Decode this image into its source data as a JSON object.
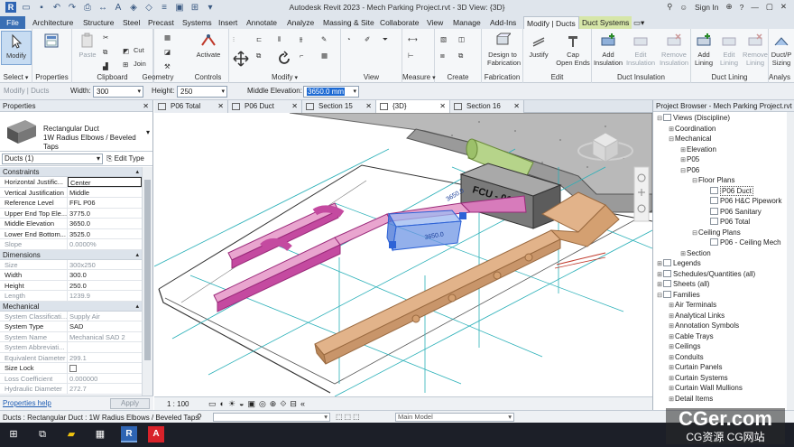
{
  "app": {
    "title": "Autodesk Revit 2023 - Mech Parking Project.rvt - 3D View: {3D}",
    "sign_in": "Sign In",
    "logo": "R"
  },
  "tabs": [
    "File",
    "Architecture",
    "Structure",
    "Steel",
    "Precast",
    "Systems",
    "Insert",
    "Annotate",
    "Analyze",
    "Massing & Site",
    "Collaborate",
    "View",
    "Manage",
    "Add-Ins",
    "Modify | Ducts",
    "Duct Systems"
  ],
  "ribbon": {
    "select": {
      "button": "Modify",
      "label": "Select"
    },
    "properties": {
      "label": "Properties"
    },
    "clipboard": {
      "paste": "Paste",
      "cut": "Cut",
      "join": "Join",
      "label": "Clipboard"
    },
    "geometry": {
      "label": "Geometry"
    },
    "controls": {
      "activate": "Activate",
      "label": "Controls"
    },
    "modify": {
      "label": "Modify"
    },
    "view": {
      "label": "View"
    },
    "measure": {
      "label": "Measure"
    },
    "create": {
      "label": "Create"
    },
    "fabrication": {
      "button1": "Design to",
      "button2": "Fabrication",
      "label": "Fabrication"
    },
    "edit": {
      "justify": "Justify",
      "cap1": "Cap",
      "cap2": "Open Ends",
      "label": "Edit"
    },
    "duct_insulation": {
      "add1": "Add",
      "add2": "Insulation",
      "edit1": "Edit",
      "edit2": "Insulation",
      "remove1": "Remove",
      "remove2": "Insulation",
      "label": "Duct Insulation"
    },
    "duct_lining": {
      "add1": "Add",
      "add2": "Lining",
      "edit1": "Edit",
      "edit2": "Lining",
      "remove1": "Remove",
      "remove2": "Lining",
      "label": "Duct Lining"
    },
    "analysis": {
      "btn1": "Duct/P",
      "btn2": "Sizing",
      "label": "Analys"
    }
  },
  "options_bar": {
    "context": "Modify | Ducts",
    "width_label": "Width:",
    "width_value": "300",
    "height_label": "Height:",
    "height_value": "250",
    "elev_label": "Middle Elevation:",
    "elev_value": "3650.0 mm"
  },
  "properties_panel": {
    "title": "Properties",
    "family": "Rectangular Duct",
    "type": "1W Radius Elbows / Beveled Taps",
    "instance": "Ducts (1)",
    "edit_type": "Edit Type",
    "help": "Properties help",
    "apply": "Apply",
    "sections": [
      {
        "name": "Constraints",
        "rows": [
          {
            "k": "Horizontal Justific...",
            "v": "Center",
            "hi": true
          },
          {
            "k": "Vertical Justification",
            "v": "Middle"
          },
          {
            "k": "Reference Level",
            "v": "FFL P06"
          },
          {
            "k": "Upper End Top Ele...",
            "v": "3775.0"
          },
          {
            "k": "Middle Elevation",
            "v": "3650.0"
          },
          {
            "k": "Lower End Bottom...",
            "v": "3525.0"
          },
          {
            "k": "Slope",
            "v": "0.0000%",
            "ro": true
          }
        ]
      },
      {
        "name": "Dimensions",
        "rows": [
          {
            "k": "Size",
            "v": "300x250",
            "ro": true
          },
          {
            "k": "Width",
            "v": "300.0"
          },
          {
            "k": "Height",
            "v": "250.0"
          },
          {
            "k": "Length",
            "v": "1239.9",
            "ro": true
          }
        ]
      },
      {
        "name": "Mechanical",
        "rows": [
          {
            "k": "System Classificati...",
            "v": "Supply Air",
            "ro": true
          },
          {
            "k": "System Type",
            "v": "SAD"
          },
          {
            "k": "System Name",
            "v": "Mechanical SAD 2",
            "ro": true
          },
          {
            "k": "System Abbreviati...",
            "v": "",
            "ro": true
          },
          {
            "k": "Equivalent Diameter",
            "v": "299.1",
            "ro": true
          },
          {
            "k": "Size Lock",
            "v": "",
            "chk": true
          },
          {
            "k": "Loss Coefficient",
            "v": "0.000000",
            "ro": true
          },
          {
            "k": "Hydraulic Diameter",
            "v": "272.7",
            "ro": true
          }
        ]
      }
    ]
  },
  "view_tabs": [
    "P06 Total",
    "P06 Duct",
    "Section 15",
    "{3D}",
    "Section 16"
  ],
  "canvas": {
    "unit_label": "FCU - 01",
    "dim1": "3650.0",
    "dim2": "3650.0"
  },
  "view_control": {
    "scale": "1 : 100"
  },
  "project_browser": {
    "title": "Project Browser - Mech Parking Project.rvt",
    "items": [
      {
        "t": "Views (Discipline)",
        "lvl": 0,
        "tg": "⊟"
      },
      {
        "t": "Coordination",
        "lvl": 1,
        "tg": "⊞"
      },
      {
        "t": "Mechanical",
        "lvl": 1,
        "tg": "⊟"
      },
      {
        "t": "Elevation",
        "lvl": 2,
        "tg": "⊞"
      },
      {
        "t": "P05",
        "lvl": 2,
        "tg": "⊞"
      },
      {
        "t": "P06",
        "lvl": 2,
        "tg": "⊟"
      },
      {
        "t": "Floor Plans",
        "lvl": 3,
        "tg": "⊟"
      },
      {
        "t": "P06 Duct",
        "lvl": 4,
        "tg": "",
        "cur": true
      },
      {
        "t": "P06 H&C Pipework",
        "lvl": 4,
        "tg": ""
      },
      {
        "t": "P06 Sanitary",
        "lvl": 4,
        "tg": ""
      },
      {
        "t": "P06 Total",
        "lvl": 4,
        "tg": ""
      },
      {
        "t": "Ceiling Plans",
        "lvl": 3,
        "tg": "⊟"
      },
      {
        "t": "P06 - Ceiling Mech",
        "lvl": 4,
        "tg": ""
      },
      {
        "t": "Section",
        "lvl": 2,
        "tg": "⊞"
      },
      {
        "t": "Legends",
        "lvl": 0,
        "tg": "⊞",
        "ib": true
      },
      {
        "t": "Schedules/Quantities (all)",
        "lvl": 0,
        "tg": "⊞",
        "ib": true
      },
      {
        "t": "Sheets (all)",
        "lvl": 0,
        "tg": "⊞",
        "ib": true
      },
      {
        "t": "Families",
        "lvl": 0,
        "tg": "⊟",
        "ib": true
      },
      {
        "t": "Air Terminals",
        "lvl": 1,
        "tg": "⊞"
      },
      {
        "t": "Analytical Links",
        "lvl": 1,
        "tg": "⊞"
      },
      {
        "t": "Annotation Symbols",
        "lvl": 1,
        "tg": "⊞"
      },
      {
        "t": "Cable Trays",
        "lvl": 1,
        "tg": "⊞"
      },
      {
        "t": "Ceilings",
        "lvl": 1,
        "tg": "⊞"
      },
      {
        "t": "Conduits",
        "lvl": 1,
        "tg": "⊞"
      },
      {
        "t": "Curtain Panels",
        "lvl": 1,
        "tg": "⊞"
      },
      {
        "t": "Curtain Systems",
        "lvl": 1,
        "tg": "⊞"
      },
      {
        "t": "Curtain Wall Mullions",
        "lvl": 1,
        "tg": "⊞"
      },
      {
        "t": "Detail Items",
        "lvl": 1,
        "tg": "⊞"
      }
    ]
  },
  "status_bar": {
    "text": "Ducts : Rectangular Duct : 1W Radius Elbows / Beveled Taps",
    "model": "Main Model"
  },
  "watermark": {
    "line1": "CGer.com",
    "line2": "CG资源 CG网站"
  },
  "colors": {
    "accent": "#3a6fb4",
    "selection": "#1d6ad3",
    "duct_pink": "#c44aa0",
    "duct_tan": "#d4a071",
    "selected_blue": "#2d62d6"
  }
}
